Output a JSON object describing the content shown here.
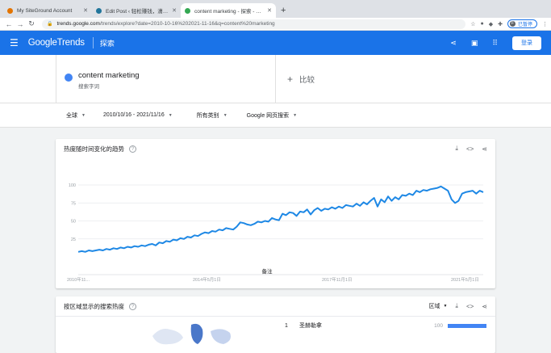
{
  "browser": {
    "tabs": [
      {
        "title": "My SiteGround Account",
        "active": false,
        "favicon_color": "#e37400"
      },
      {
        "title": "Edit Post ‹ 轻松赚钱，潇洒生活",
        "active": false,
        "favicon_color": "#21759b"
      },
      {
        "title": "content marketing - 探索 - Goo...",
        "active": true,
        "favicon_color": "#34a853"
      }
    ],
    "new_tab": "+",
    "url_host": "trends.google.com",
    "url_rest": "/trends/explore?date=2010-10-16%202021-11-16&q=content%20marketing",
    "pause_label": "已暂停",
    "avatar_letter": "F"
  },
  "header": {
    "logo_google": "Google",
    "logo_trends": "Trends",
    "section": "探索",
    "login": "登录"
  },
  "compare": {
    "term": "content marketing",
    "term_sub": "搜索字词",
    "term_color": "#4285f4",
    "compare_label": "比较"
  },
  "filters": [
    {
      "label": "全球"
    },
    {
      "label": "2010/10/16 - 2021/11/16"
    },
    {
      "label": "所有类别"
    },
    {
      "label": "Google 网页搜索"
    }
  ],
  "interest_card": {
    "title": "热度随时间变化的趋势",
    "note_label": "备注"
  },
  "region_card": {
    "title": "按区域显示的搜索热度",
    "region_select": "区域",
    "rank": {
      "num": "1",
      "name": "圣赫勒拿",
      "value": "100"
    }
  },
  "chart_data": {
    "type": "line",
    "series": [
      {
        "name": "content marketing",
        "color": "#1e88e5",
        "values": [
          7,
          8,
          7,
          9,
          8,
          9,
          10,
          9,
          11,
          10,
          12,
          11,
          13,
          12,
          14,
          13,
          15,
          14,
          16,
          15,
          17,
          18,
          16,
          20,
          19,
          22,
          21,
          24,
          23,
          26,
          25,
          28,
          27,
          30,
          29,
          32,
          34,
          33,
          36,
          35,
          38,
          37,
          40,
          39,
          38,
          42,
          48,
          47,
          45,
          44,
          46,
          49,
          48,
          50,
          49,
          54,
          52,
          51,
          60,
          58,
          62,
          61,
          57,
          63,
          62,
          66,
          59,
          65,
          68,
          64,
          67,
          66,
          69,
          67,
          70,
          68,
          72,
          71,
          70,
          74,
          71,
          76,
          73,
          78,
          82,
          70,
          80,
          76,
          84,
          78,
          83,
          80,
          86,
          85,
          88,
          86,
          92,
          90,
          93,
          92,
          94,
          95,
          96,
          98,
          95,
          92,
          80,
          75,
          78,
          88,
          90,
          91,
          92,
          88,
          92,
          90
        ]
      }
    ],
    "ylim": [
      0,
      100
    ],
    "y_ticks": [
      100,
      75,
      50,
      25
    ],
    "x_ticks": [
      "2010年11...",
      "2014年5月1日",
      "2017年11月1日",
      "2021年5月1日"
    ],
    "grid": true
  }
}
